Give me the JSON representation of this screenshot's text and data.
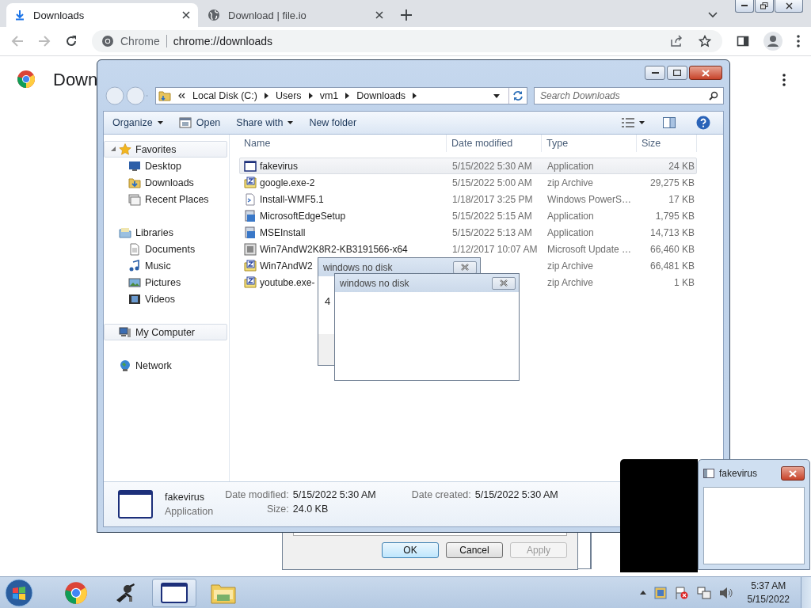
{
  "browser": {
    "tabs": [
      {
        "title": "Downloads",
        "selected": true
      },
      {
        "title": "Download | file.io",
        "selected": false
      }
    ],
    "site_label": "Chrome",
    "url": "chrome://downloads",
    "page_heading": "Down"
  },
  "explorer": {
    "breadcrumb": [
      "Local Disk (C:)",
      "Users",
      "vm1",
      "Downloads"
    ],
    "search_placeholder": "Search Downloads",
    "commands": [
      {
        "label": "Organize",
        "kind": "menu"
      },
      {
        "label": "Open",
        "kind": "icon"
      },
      {
        "label": "Share with",
        "kind": "menu"
      },
      {
        "label": "New folder",
        "kind": "plain"
      }
    ],
    "nav": [
      {
        "label": "Favorites",
        "highlighted": true,
        "children": [
          {
            "label": "Desktop",
            "highlighted": false
          },
          {
            "label": "Downloads",
            "highlighted": false
          },
          {
            "label": "Recent Places",
            "highlighted": false
          }
        ]
      },
      {
        "label": "Libraries",
        "highlighted": false,
        "children": [
          {
            "label": "Documents",
            "highlighted": false
          },
          {
            "label": "Music",
            "highlighted": false
          },
          {
            "label": "Pictures",
            "highlighted": false
          },
          {
            "label": "Videos",
            "highlighted": false
          }
        ]
      },
      {
        "label": "My Computer",
        "highlighted": true
      },
      {
        "label": "Network",
        "highlighted": false
      }
    ],
    "columns": [
      "Name",
      "Date modified",
      "Type",
      "Size"
    ],
    "files": [
      {
        "name": "fakevirus",
        "date": "5/15/2022 5:30 AM",
        "type": "Application",
        "size": "24 KB",
        "selected": true
      },
      {
        "name": "google.exe-2",
        "date": "5/15/2022 5:00 AM",
        "type": "zip Archive",
        "size": "29,275 KB",
        "selected": false
      },
      {
        "name": "Install-WMF5.1",
        "date": "1/18/2017 3:25 PM",
        "type": "Windows PowerS…",
        "size": "17 KB",
        "selected": false
      },
      {
        "name": "MicrosoftEdgeSetup",
        "date": "5/15/2022 5:15 AM",
        "type": "Application",
        "size": "1,795 KB",
        "selected": false
      },
      {
        "name": "MSEInstall",
        "date": "5/15/2022 5:13 AM",
        "type": "Application",
        "size": "14,713 KB",
        "selected": false
      },
      {
        "name": "Win7AndW2K8R2-KB3191566-x64",
        "date": "1/12/2017 10:07 AM",
        "type": "Microsoft Update …",
        "size": "66,460 KB",
        "selected": false
      },
      {
        "name": "Win7AndW2",
        "type": "zip Archive",
        "size": "66,481 KB",
        "selected": false
      },
      {
        "name": "youtube.exe-",
        "type": "zip Archive",
        "size": "1 KB",
        "selected": false
      }
    ],
    "details": {
      "name": "fakevirus",
      "type": "Application",
      "modified_label": "Date modified:",
      "modified": "5/15/2022 5:30 AM",
      "size_label": "Size:",
      "size": "24.0 KB",
      "created_label": "Date created:",
      "created": "5/15/2022 5:30 AM"
    }
  },
  "dialogs": [
    {
      "title": "windows no disk",
      "text": "4"
    },
    {
      "title": "windows no disk"
    }
  ],
  "properties_buttons": [
    {
      "label": "OK",
      "focused": true,
      "disabled": false
    },
    {
      "label": "Cancel",
      "focused": false,
      "disabled": false
    },
    {
      "label": "Apply",
      "focused": false,
      "disabled": true
    }
  ],
  "mini_window": {
    "title": "fakevirus"
  },
  "taskbar": {
    "apps": [
      {
        "active": false
      },
      {
        "active": false
      },
      {
        "active": true
      },
      {
        "active": false
      }
    ],
    "time": "5:37 AM",
    "date": "5/15/2022"
  }
}
